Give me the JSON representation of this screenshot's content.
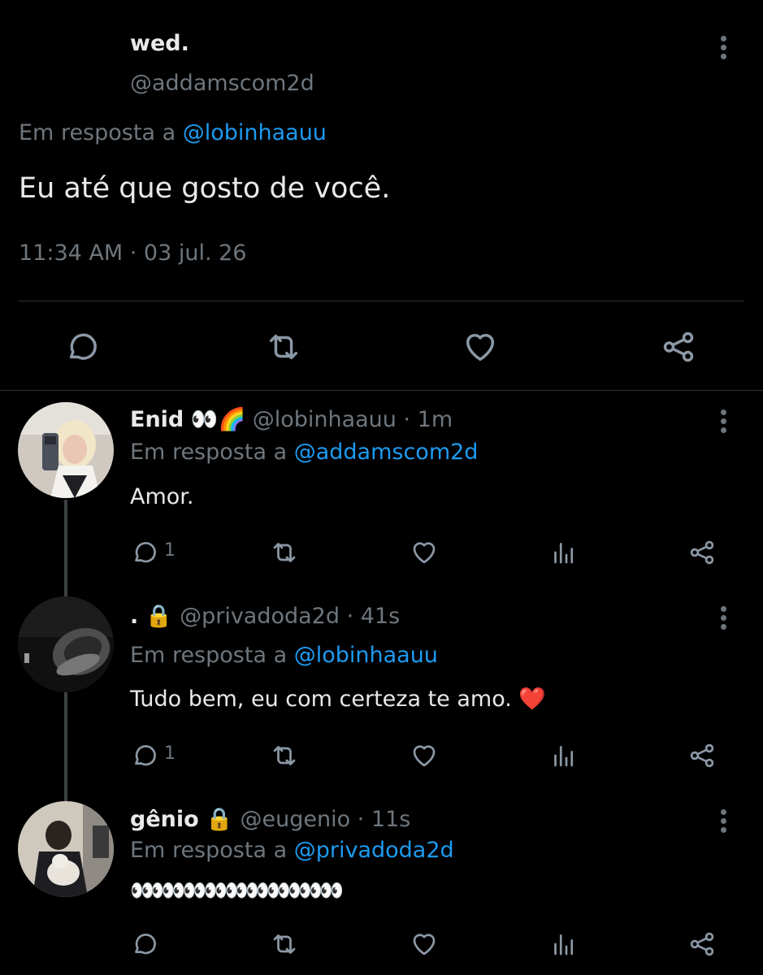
{
  "main": {
    "name": "wed.",
    "handle": "@addamscom2d",
    "reply_prefix": "Em resposta a",
    "reply_to": "@lobinhaauu",
    "text": "Eu até que gosto de você.",
    "timestamp": "11:34 AM · 03 jul. 26",
    "actions": [
      "reply-icon",
      "retweet-icon",
      "like-icon",
      "share-icon"
    ]
  },
  "replies": [
    {
      "name": "Enid",
      "name_emoji": "👀🌈",
      "handle_time": "@lobinhaauu · 1m",
      "reply_prefix": "Em resposta a",
      "reply_to": "@addamscom2d",
      "text": "Amor.",
      "reply_count": "1"
    },
    {
      "name": ".",
      "name_emoji": "🔒",
      "handle_time": "@privadoda2d · 41s",
      "reply_prefix": "Em resposta a",
      "reply_to": "@lobinhaauu",
      "text": "Tudo bem, eu com certeza te amo. ❤️",
      "reply_count": "1"
    },
    {
      "name": "gênio",
      "name_emoji": "🔒",
      "handle_time": "@eugenio · 11s",
      "reply_prefix": "Em resposta a",
      "reply_to": "@privadoda2d",
      "text": "👀👀👀👀👀👀👀👀👀👀",
      "reply_count": ""
    }
  ],
  "colors": {
    "background": "#000000",
    "text": "#e7e9ea",
    "muted": "#6e767d",
    "link": "#1d9bf0"
  }
}
